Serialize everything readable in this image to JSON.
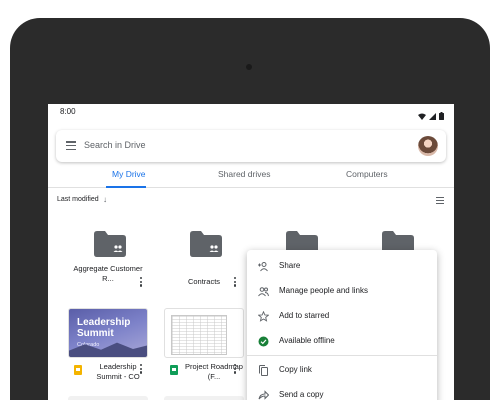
{
  "status_bar": {
    "time": "8:00"
  },
  "search": {
    "placeholder": "Search in Drive"
  },
  "tabs": [
    {
      "label": "My Drive",
      "active": true
    },
    {
      "label": "Shared drives",
      "active": false
    },
    {
      "label": "Computers",
      "active": false
    }
  ],
  "sort": {
    "label": "Last modified"
  },
  "folders": [
    {
      "name": "Aggregate Customer R...",
      "icon": "shared-folder-icon"
    },
    {
      "name": "Contracts",
      "icon": "shared-folder-icon"
    },
    {
      "name": "",
      "icon": "folder-icon"
    },
    {
      "name": "",
      "icon": "folder-icon"
    }
  ],
  "files": [
    {
      "name": "Leadership Summit - CO",
      "type": "slides",
      "thumb_title": "Leadership Summit",
      "thumb_subtitle": "Colorado"
    },
    {
      "name": "Project Roadmap (F...",
      "type": "sheets"
    }
  ],
  "context_menu": {
    "items": [
      {
        "label": "Share",
        "icon": "person-add-icon"
      },
      {
        "label": "Manage people and links",
        "icon": "people-icon"
      },
      {
        "label": "Add to starred",
        "icon": "star-outline-icon"
      },
      {
        "label": "Available offline",
        "icon": "offline-check-icon"
      },
      {
        "label": "Copy link",
        "icon": "copy-icon"
      },
      {
        "label": "Send a copy",
        "icon": "send-icon"
      }
    ]
  },
  "colors": {
    "accent": "#1a73e8",
    "device_frame": "#2b2b2b",
    "folder": "#5f6368",
    "offline_green": "#188038",
    "slides_yellow": "#f4b400",
    "sheets_green": "#0f9d58"
  }
}
